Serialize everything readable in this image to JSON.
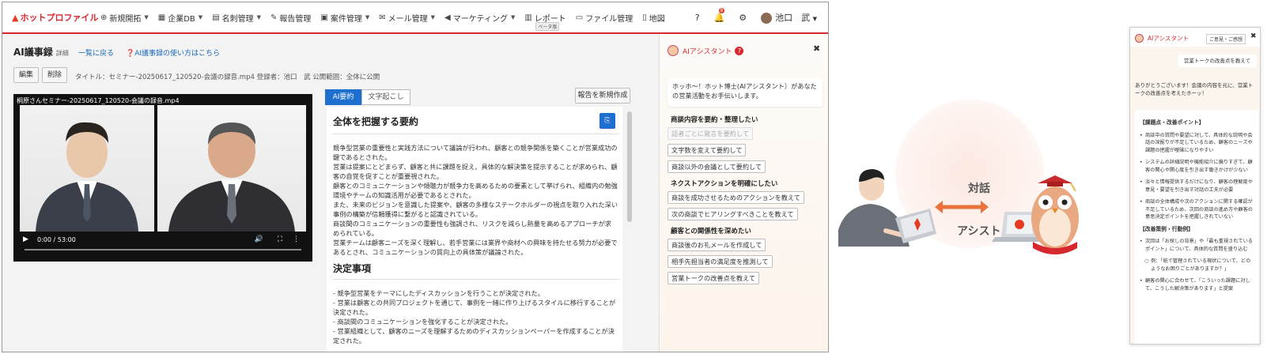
{
  "nav": {
    "logo": "ホットプロファイル",
    "items": [
      {
        "label": "新規開拓",
        "icon": "crosshair-icon",
        "chevron": true
      },
      {
        "label": "企業DB",
        "icon": "building-icon",
        "chevron": true
      },
      {
        "label": "名刺管理",
        "icon": "card-icon",
        "chevron": true
      },
      {
        "label": "報告管理",
        "icon": "edit-icon",
        "chevron": false
      },
      {
        "label": "案件管理",
        "icon": "briefcase-icon",
        "chevron": true
      },
      {
        "label": "メール管理",
        "icon": "mail-icon",
        "chevron": true
      },
      {
        "label": "マーケティング",
        "icon": "megaphone-icon",
        "chevron": true
      },
      {
        "label": "レポート",
        "icon": "chart-icon",
        "chevron": false,
        "badge": "ベータ版"
      },
      {
        "label": "ファイル管理",
        "icon": "folder-icon",
        "chevron": false
      },
      {
        "label": "地図",
        "icon": "map-icon",
        "chevron": false
      }
    ],
    "notification_count": "8",
    "user_name": "池口　武"
  },
  "page": {
    "title": "AI議事録",
    "title_sub": "詳細",
    "back_link": "一覧に戻る",
    "help_link": "AI議事録の使い方はこちら",
    "edit_btn": "編集",
    "delete_btn": "削除",
    "meta": "タイトル：セミナー-20250617_120520-会議の録音.mp4 登録者：池口　武 公開範囲：全体に公開"
  },
  "video": {
    "title": "桐原さんセミナー-20250617_120520-会議の録音.mp4",
    "time": "0:00 / 53:00",
    "progress": 0
  },
  "tabs": [
    {
      "label": "AI要約",
      "active": true
    },
    {
      "label": "文字起こし",
      "active": false
    }
  ],
  "create_report_btn": "報告を新規作成",
  "summary": {
    "heading1": "全体を把握する要約",
    "para1": [
      "競争型営業の重要性と実践方法について議論が行われ、顧客との競争関係を築くことが営業成功の鍵であるとされた。",
      "営業は提案にとどまらず、顧客と共に課題を捉え、具体的な解決策を提示することが求められ、顧客の自覚を促すことが重要視された。",
      "顧客とのコミュニケーションや傾聴力が競争力を高めるための要素として挙げられ、組織内の勉強環境やチームの知識活用が必要であるとされた。",
      "また、未来のビジョンを意識した提案や、顧客の多様なステークホルダーの視点を取り入れた深い事例の構築が信頼獲得に繋がると認識されている。",
      "商談間のコミュニケーションの重要性も強調され、リスクを減らし熱量を高めるアプローチが求められている。",
      "営業チームは顧客ニーズを深く理解し、若手営業には業界や商材への興味を持たせる努力が必要であるとされ、コミュニケーションの質向上の具体策が議論された。"
    ],
    "heading2": "決定事項",
    "para2": [
      "- 競争型営業をテーマにしたディスカッションを行うことが決定された。",
      "- 営業は顧客との共同プロジェクトを通じて、事例を一緒に作り上げるスタイルに移行することが決定された。",
      "- 商談間のコミュニケーションを強化することが決定された。",
      "- 営業組織として、顧客のニーズを理解するためのディスカッションペーパーを作成することが決定された。"
    ]
  },
  "assistant": {
    "title": "AIアシスタント",
    "intro": "ホッホ〜！ホット博士(AIアシスタント）があなたの営業活動をお手伝いします。",
    "sections": [
      {
        "title": "商談内容を要約・整理したい",
        "buttons": [
          {
            "label": "話者ごとに発言を要約して",
            "disabled": true
          },
          {
            "label": "文字数を変えて要約して",
            "disabled": false
          },
          {
            "label": "商談以外の会議として要約して",
            "disabled": false
          }
        ]
      },
      {
        "title": "ネクストアクションを明確にしたい",
        "buttons": [
          {
            "label": "商談を成功させるためのアクションを教えて",
            "disabled": false
          },
          {
            "label": "次の商談でヒアリングすべきことを教えて",
            "disabled": false
          }
        ]
      },
      {
        "title": "顧客との関係性を深めたい",
        "buttons": [
          {
            "label": "商談後のお礼メールを作成して",
            "disabled": false
          },
          {
            "label": "相手先担当者の満足度を推測して",
            "disabled": false
          },
          {
            "label": "営業トークの改善点を教えて",
            "disabled": false
          }
        ]
      }
    ]
  },
  "illustration": {
    "talk": "対話",
    "assist": "アシスト"
  },
  "chat": {
    "title": "AIアシスタント",
    "feedback_btn": "ご意見・ご感想",
    "user_msg": "営業トークの改善点を教えて",
    "bot_msg": "ありがとうございます！会議の内容を元に、営業トークの改善点を考えたホーッ！",
    "h1": "【課題点・改善ポイント】",
    "points1": [
      "商談中の質問や要望に対して、具体的な説明や会話の深掘りが不足しているため、顧客のニーズや課題の把握が曖昧になりやすい",
      "システムの詳細説明や機能紹介に偏りすぎて、顧客の関心や関心度を引き出す働きかけが少ない",
      "淡々と情報提供するだけになり、顧客の理解度や意見・要望を引き出す対話の工夫が必要",
      "商談の全体構成や次のアクションに関する確認が不足しているため、次回の商談の進め方や顧客の意思決定ポイントを把握しきれていない"
    ],
    "h2": "【改善策例・行動例】",
    "points2": [
      "次回は「お探しの背景」や「最も重視されているポイント」について、具体的な質問を盛り込む",
      "例：「紙で管理されている現状について、どのようなお困りごとがありますか？」",
      "顧客の関心に合わせて、「こういった課題に対して、こうした解決策があります」と提案"
    ]
  }
}
